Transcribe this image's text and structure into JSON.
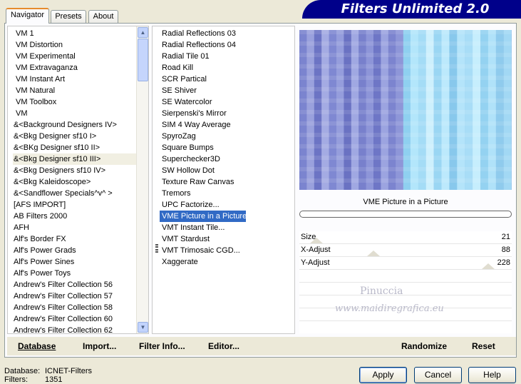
{
  "tabs": [
    "Navigator",
    "Presets",
    "About"
  ],
  "banner_title": "Filters Unlimited 2.0",
  "categories": [
    "VM 1",
    "VM Distortion",
    "VM Experimental",
    "VM Extravaganza",
    "VM Instant Art",
    "VM Natural",
    "VM Toolbox",
    "VM",
    "&<Background Designers IV>",
    "&<Bkg Designer sf10 I>",
    "&<BKg Designer sf10 II>",
    "&<Bkg Designer sf10 III>",
    "&<Bkg Designers sf10 IV>",
    "&<Bkg Kaleidoscope>",
    "&<Sandflower Specials^v^ >",
    "[AFS IMPORT]",
    "AB Filters 2000",
    "AFH",
    "Alf's Border FX",
    "Alf's Power Grads",
    "Alf's Power Sines",
    "Alf's Power Toys",
    "Andrew's Filter Collection 56",
    "Andrew's Filter Collection 57",
    "Andrew's Filter Collection 58",
    "Andrew's Filter Collection 60",
    "Andrew's Filter Collection 62"
  ],
  "selected_category_index": 11,
  "filters": [
    "Radial Reflections 03",
    "Radial Reflections 04",
    "Radial Tile 01",
    "Road Kill",
    "SCR  Partical",
    "SE Shiver",
    "SE Watercolor",
    "Sierpenski's Mirror",
    "SIM 4 Way Average",
    "SpyroZag",
    "Square Bumps",
    "Superchecker3D",
    "SW Hollow Dot",
    "Texture Raw Canvas",
    "Tremors",
    "UPC Factorize...",
    "VME Picture in a Picture",
    "VMT Instant Tile...",
    "VMT Stardust",
    "VMT Trimosaic CGD...",
    "Xaggerate"
  ],
  "selected_filter_index": 16,
  "filter_name": "VME Picture in a Picture",
  "params": [
    {
      "label": "Size",
      "value": "21",
      "level": 0.08
    },
    {
      "label": "X-Adjust",
      "value": "88",
      "level": 0.35
    },
    {
      "label": "Y-Adjust",
      "value": "228",
      "level": 0.89
    }
  ],
  "watermark": {
    "line1": "Pinuccia",
    "line2": "www.maidiregrafica.eu"
  },
  "toolbar": {
    "database": "Database",
    "import": "Import...",
    "filter_info": "Filter Info...",
    "editor": "Editor...",
    "randomize": "Randomize",
    "reset": "Reset"
  },
  "footer": {
    "database_label": "Database:",
    "database_value": "ICNET-Filters",
    "filters_label": "Filters:",
    "filters_value": "1351"
  },
  "buttons": {
    "apply": "Apply",
    "cancel": "Cancel",
    "help": "Help"
  },
  "colors": {
    "banner": "#00008a",
    "selection": "#316ac5"
  }
}
